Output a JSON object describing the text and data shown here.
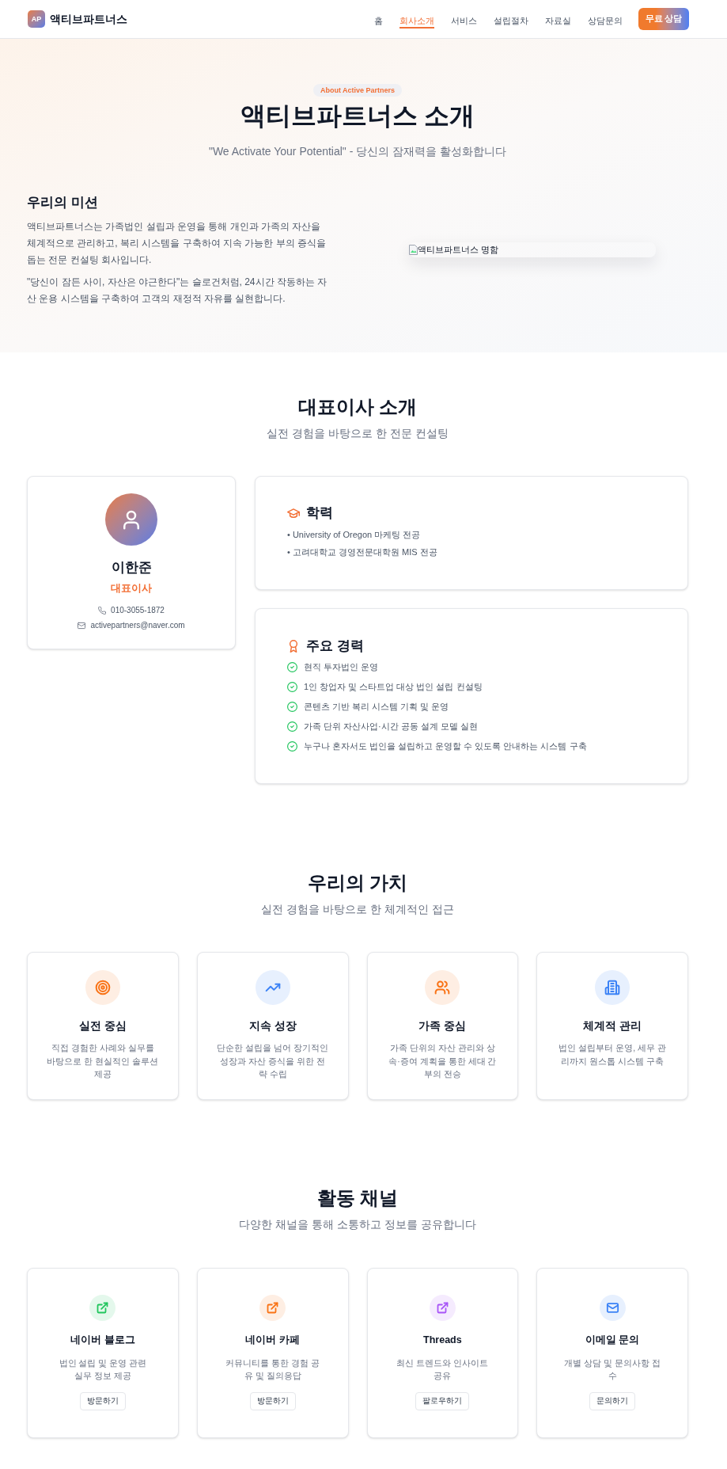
{
  "header": {
    "logo_mark": "AP",
    "logo_text": "액티브파트너스",
    "nav": [
      {
        "label": "홈",
        "selected": false
      },
      {
        "label": "회사소개",
        "selected": true
      },
      {
        "label": "서비스",
        "selected": false
      },
      {
        "label": "설립절차",
        "selected": false
      },
      {
        "label": "자료실",
        "selected": false
      },
      {
        "label": "상담문의",
        "selected": false
      }
    ],
    "cta": "무료 상담"
  },
  "hero": {
    "badge": "About Active Partners",
    "title": "액티브파트너스 소개",
    "subtitle": "\"We Activate Your Potential\" - 당신의 잠재력을 활성화합니다",
    "mission": {
      "heading": "우리의 미션",
      "paragraphs": [
        "액티브파트너스는 가족법인 설립과 운영을 통해 개인과 가족의 자산을 체계적으로 관리하고, 복리 시스템을 구축하여 지속 가능한 부의 증식을 돕는 전문 컨설팅 회사입니다.",
        "\"당신이 잠든 사이, 자산은 야근한다\"는 슬로건처럼, 24시간 작동하는 자산 운용 시스템을 구축하여 고객의 재정적 자유를 실현합니다."
      ]
    },
    "image_alt": "액티브파트너스 명함"
  },
  "ceo_section": {
    "title": "대표이사 소개",
    "subtitle": "실전 경험을 바탕으로 한 전문 컨설팅",
    "profile": {
      "name": "이한준",
      "role": "대표이사",
      "phone": "010-3055-1872",
      "email": "activepartners@naver.com"
    },
    "education": {
      "heading": "학력",
      "items": [
        "• University of Oregon 마케팅 전공",
        "• 고려대학교 경영전문대학원 MIS 전공"
      ]
    },
    "career": {
      "heading": "주요 경력",
      "items": [
        "현직 투자법인 운영",
        "1인 창업자 및 스타트업 대상 법인 설립 컨설팅",
        "콘텐츠 기반 복리 시스템 기획 및 운영",
        "가족 단위 자산사업·시간 공동 설계 모델 실현",
        "누구나 혼자서도 법인을 설립하고 운영할 수 있도록 안내하는 시스템 구축"
      ]
    }
  },
  "values_section": {
    "title": "우리의 가치",
    "subtitle": "실전 경험을 바탕으로 한 체계적인 접근",
    "cards": [
      {
        "title": "실전 중심",
        "description": "직접 경험한 사례와 실무를 바탕으로 한 현실적인 솔루션 제공",
        "color": "#f97316"
      },
      {
        "title": "지속 성장",
        "description": "단순한 설립을 넘어 장기적인 성장과 자산 증식을 위한 전략 수립",
        "color": "#3b82f6"
      },
      {
        "title": "가족 중심",
        "description": "가족 단위의 자산 관리와 상속·증여 계획을 통한 세대 간 부의 전승",
        "color": "#f97316"
      },
      {
        "title": "체계적 관리",
        "description": "법인 설립부터 운영, 세무 관리까지 원스톱 시스템 구축",
        "color": "#3b82f6"
      }
    ]
  },
  "channels_section": {
    "title": "활동 채널",
    "subtitle": "다양한 채널을 통해 소통하고 정보를 공유합니다",
    "cards": [
      {
        "title": "네이버 블로그",
        "description": "법인 설립 및 운영 관련 실무 정보 제공",
        "button": "방문하기",
        "color": "#22c55e"
      },
      {
        "title": "네이버 카페",
        "description": "커뮤니티를 통한 경험 공유 및 질의응답",
        "button": "방문하기",
        "color": "#f97316"
      },
      {
        "title": "Threads",
        "description": "최신 트렌드와 인사이트 공유",
        "button": "팔로우하기",
        "color": "#a855f7"
      },
      {
        "title": "이메일 문의",
        "description": "개별 상담 및 문의사항 접수",
        "button": "문의하기",
        "color": "#3b82f6"
      }
    ]
  }
}
